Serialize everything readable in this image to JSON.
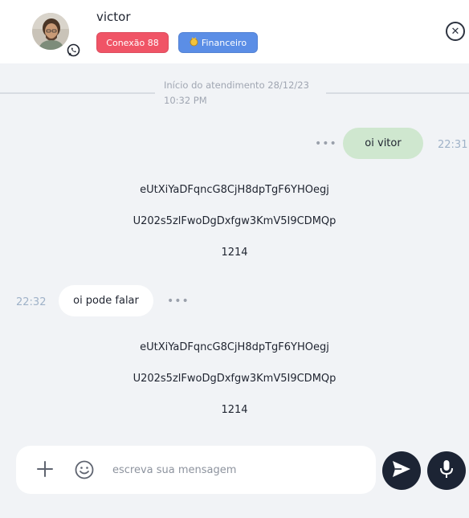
{
  "contact": {
    "name": "victor",
    "channel_icon": "whatsapp-icon"
  },
  "tags": {
    "connection": "Conexão 88",
    "department": "Financeiro",
    "department_icon": "coin-icon"
  },
  "header": {
    "close_icon": "close-icon"
  },
  "chat": {
    "start_label": "Início do atendimento 28/12/23 10:32 PM",
    "messages": [
      {
        "direction": "outgoing",
        "text": "oi vitor",
        "time": "22:31"
      },
      {
        "direction": "system",
        "lines": [
          "eUtXiYaDFqncG8CjH8dpTgF6YHOegj",
          "U202s5zlFwoDgDxfgw3KmV5I9CDMQp",
          "1214"
        ]
      },
      {
        "direction": "incoming",
        "text": "oi pode falar",
        "time": "22:32"
      },
      {
        "direction": "system",
        "lines": [
          "eUtXiYaDFqncG8CjH8dpTgF6YHOegj",
          "U202s5zlFwoDgDxfgw3KmV5I9CDMQp",
          "1214"
        ]
      }
    ],
    "more_icon": "more-dots-icon"
  },
  "composer": {
    "placeholder": "escreva sua mensagem",
    "value": "",
    "attach_icon": "plus-icon",
    "emoji_icon": "emoji-icon",
    "send_icon": "send-icon",
    "mic_icon": "mic-icon"
  },
  "colors": {
    "connection_tag": "#f05466",
    "department_tag": "#5b8ee6",
    "outgoing_bubble": "#cfe7cf",
    "incoming_bubble": "#ffffff",
    "action_button": "#1c2434",
    "background": "#f1f3f6"
  }
}
